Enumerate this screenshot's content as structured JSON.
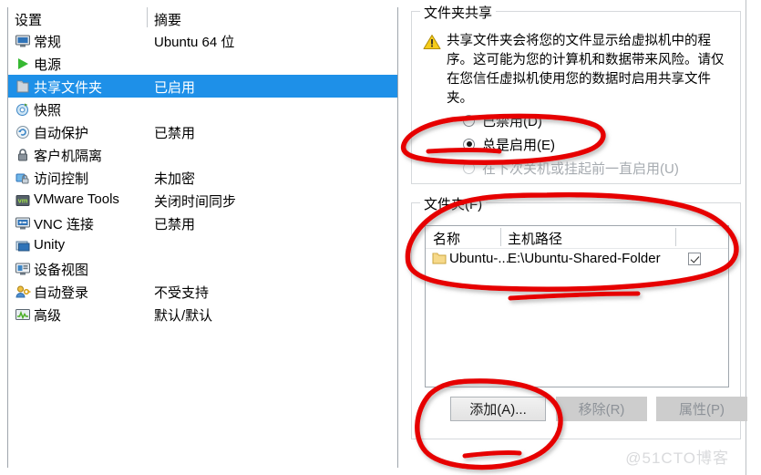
{
  "left_panel": {
    "columns": {
      "setting": "设置",
      "summary": "摘要"
    },
    "rows": [
      {
        "icon": "monitor-icon",
        "label": "常规",
        "summary": "Ubuntu 64 位",
        "selected": false
      },
      {
        "icon": "power-play-icon",
        "label": "电源",
        "summary": "",
        "selected": false
      },
      {
        "icon": "shared-folder-icon",
        "label": "共享文件夹",
        "summary": "已启用",
        "selected": true
      },
      {
        "icon": "snapshot-icon",
        "label": "快照",
        "summary": "",
        "selected": false
      },
      {
        "icon": "autoprotect-icon",
        "label": "自动保护",
        "summary": "已禁用",
        "selected": false
      },
      {
        "icon": "lock-icon",
        "label": "客户机隔离",
        "summary": "",
        "selected": false
      },
      {
        "icon": "access-control-icon",
        "label": "访问控制",
        "summary": "未加密",
        "selected": false
      },
      {
        "icon": "vmware-tools-icon",
        "label": "VMware Tools",
        "summary": "关闭时间同步",
        "selected": false
      },
      {
        "icon": "vnc-icon",
        "label": "VNC 连接",
        "summary": "已禁用",
        "selected": false
      },
      {
        "icon": "unity-icon",
        "label": "Unity",
        "summary": "",
        "selected": false
      },
      {
        "icon": "device-view-icon",
        "label": "设备视图",
        "summary": "",
        "selected": false
      },
      {
        "icon": "autologin-icon",
        "label": "自动登录",
        "summary": "不受支持",
        "selected": false
      },
      {
        "icon": "advanced-icon",
        "label": "高级",
        "summary": "默认/默认",
        "selected": false
      }
    ]
  },
  "sharing_group": {
    "legend": "文件夹共享",
    "warning_icon": "warning-triangle-icon",
    "warning_text": "共享文件夹会将您的文件显示给虚拟机中的程序。这可能为您的计算机和数据带来风险。请仅在您信任虚拟机使用您的数据时启用共享文件夹。",
    "options": [
      {
        "label": "已禁用(D)",
        "checked": false,
        "disabled": false
      },
      {
        "label": "总是启用(E)",
        "checked": true,
        "disabled": false
      },
      {
        "label": "在下次关机或挂起前一直启用(U)",
        "checked": false,
        "disabled": true
      }
    ]
  },
  "folders_group": {
    "legend": "文件夹(F)",
    "columns": {
      "name": "名称",
      "host_path": "主机路径"
    },
    "rows": [
      {
        "icon": "folder-icon",
        "name": "Ubuntu-...",
        "host_path": "E:\\Ubuntu-Shared-Folder",
        "enabled": true
      }
    ],
    "buttons": [
      {
        "label": "添加(A)...",
        "disabled": false
      },
      {
        "label": "移除(R)",
        "disabled": true
      },
      {
        "label": "属性(P)",
        "disabled": true
      }
    ]
  },
  "watermark": "@51CTO博客",
  "colors": {
    "selection_blue": "#1e90e8",
    "annotation_red": "#e60000",
    "warning_yellow": "#f5c518",
    "disabled_gray": "#a6abb0"
  }
}
